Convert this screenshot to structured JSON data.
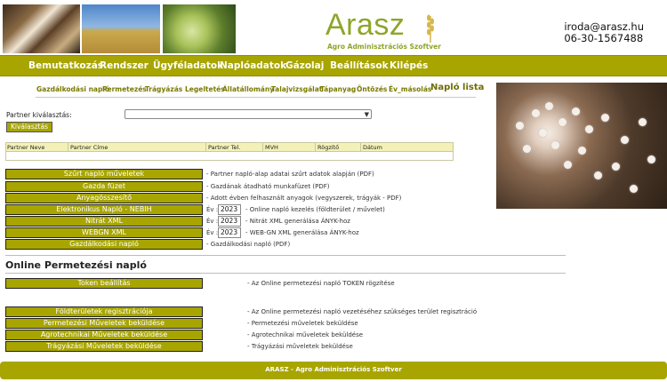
{
  "header": {
    "logo_text": "Arasz",
    "logo_sub": "Agro Adminisztrációs Szoftver",
    "email": "iroda@arasz.hu",
    "phone": "06-30-1567488"
  },
  "main_nav": [
    "Bemutatkozás",
    "Rendszer",
    "Ügyféladatok",
    "Naplóadatok",
    "Gázolaj",
    "Beállítások",
    "Kilépés"
  ],
  "sub_nav": [
    "Gazdálkodási napló",
    "Permetezés",
    "Trágyázás",
    "Legeltetés",
    "Állatállomány",
    "Talajvizsgálat",
    "Tápanyag",
    "Öntözés",
    "Év_másolás",
    "Napló lista"
  ],
  "partner": {
    "label": "Partner kiválasztás:",
    "select_value": "",
    "button": "Kiválasztás"
  },
  "partner_table": {
    "columns": [
      "Partner Neve",
      "Partner Címe",
      "Partner Tel.",
      "MVH",
      "Rögzítő",
      "Dátum"
    ]
  },
  "actions": [
    {
      "label": "Szűrt napló műveletek",
      "desc": "- Partner napló-alap adatai szűrt adatok alapján (PDF)"
    },
    {
      "label": "Gazda füzet",
      "desc": "- Gazdának átadható munkafüzet (PDF)"
    },
    {
      "label": "Anyagösszesítő",
      "desc": "- Adott évben felhasznált anyagok (vegyszerek, trágyák - PDF)"
    },
    {
      "label": "Elektronikus Napló - NEBIH",
      "year_label": "Év :",
      "year": "2023",
      "desc": "- Online napló kezelés (földterület / művelet)"
    },
    {
      "label": "Nitrát XML",
      "year_label": "Év :",
      "year": "2023",
      "desc": "- Nitrát XML generálása ÁNYK-hoz"
    },
    {
      "label": "WEBGN XML",
      "year_label": "Év :",
      "year": "2023",
      "desc": "- WEB-GN XML generálása ÁNYK-hoz"
    },
    {
      "label": "Gazdálkodási napló",
      "desc": "- Gazdálkodási napló (PDF)"
    }
  ],
  "online_section": {
    "title": "Online Permetezési napló",
    "token": {
      "label": "Token beállítás",
      "desc": "- Az Online permetezési napló TOKEN rögzítése"
    },
    "items": [
      {
        "label": "Földterületek regisztrációja",
        "desc": "- Az Online permetezési napló vezetéséhez szükséges terület regisztráció"
      },
      {
        "label": "Permetezési Műveletek beküldése",
        "desc": "- Permetezési műveletek beküldése"
      },
      {
        "label": "Agrotechnikai Műveletek beküldése",
        "desc": "- Agrotechnikai műveletek beküldése"
      },
      {
        "label": "Trágyázási Műveletek beküldése",
        "desc": "- Trágyázási műveletek beküldése"
      }
    ]
  },
  "footer": "ARASZ - Agro Adminisztrációs Szoftver",
  "colors": {
    "brand": "#a8a500",
    "logo": "#8ea52a"
  }
}
